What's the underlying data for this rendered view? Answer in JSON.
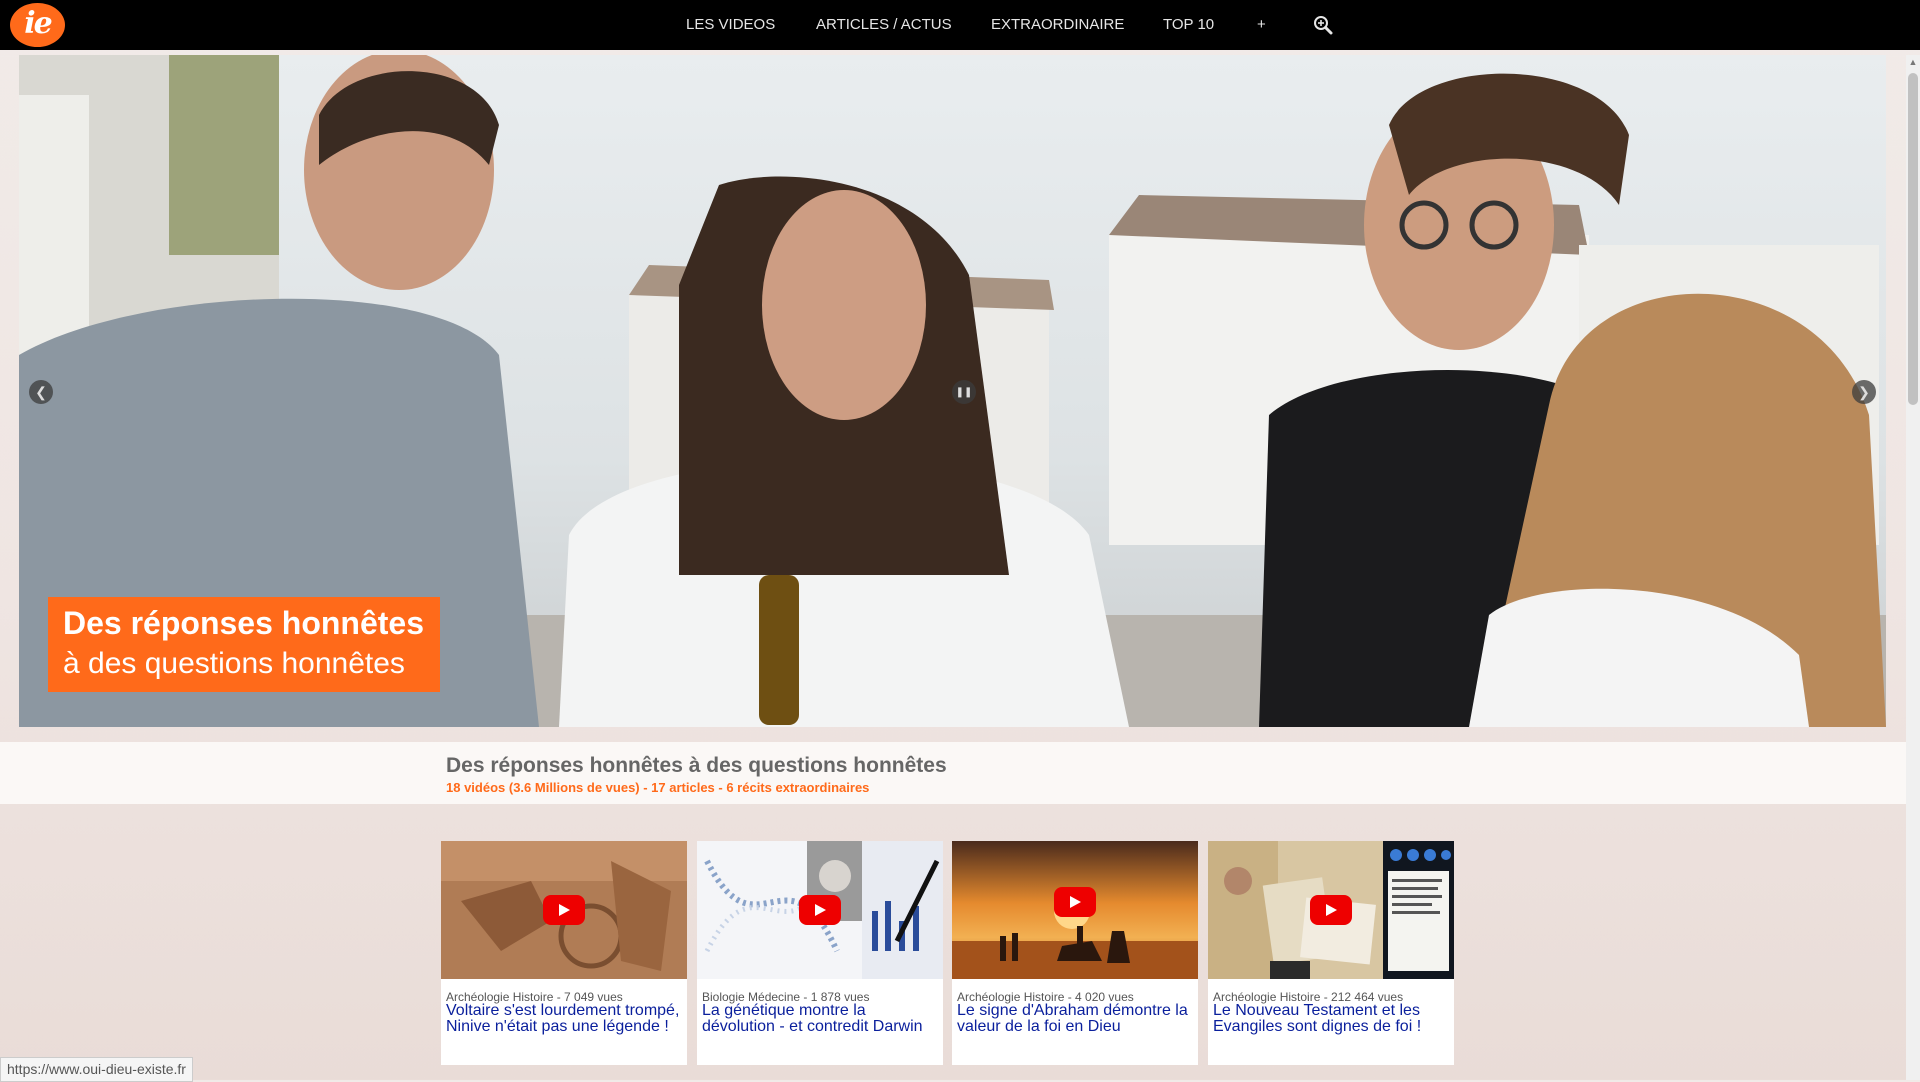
{
  "brand": {
    "logo_text": "ie"
  },
  "nav": {
    "items": [
      "LES VIDEOS",
      "ARTICLES / ACTUS",
      "EXTRAORDINAIRE",
      "TOP 10",
      "+"
    ],
    "search_icon": "search-zoom-icon"
  },
  "hero": {
    "title": "Des réponses honnêtes",
    "subtitle": "à des questions honnêtes",
    "prev_icon": "chevron-left-icon",
    "pause_icon": "pause-icon",
    "next_icon": "chevron-right-icon"
  },
  "band": {
    "title": "Des réponses honnêtes à des questions honnêtes",
    "stats": "18 vidéos  (3.6 Millions de vues)   -   17 articles   -   6 récits extraordinaires"
  },
  "videos": [
    {
      "meta": "Archéologie Histoire - 7 049 vues",
      "title": "Voltaire s'est lourdement trompé, Ninive n'était pas une légende !"
    },
    {
      "meta": "Biologie Médecine - 1 878 vues",
      "title": "La génétique montre la dévolution - et contredit Darwin"
    },
    {
      "meta": "Archéologie Histoire - 4 020 vues",
      "title": "Le signe d'Abraham démontre la valeur de la foi en Dieu"
    },
    {
      "meta": "Archéologie Histoire - 212 464 vues",
      "title": "Le Nouveau Testament et les Evangiles sont dignes de foi !"
    }
  ],
  "status_url": "https://www.oui-dieu-existe.fr",
  "colors": {
    "accent": "#ff6a1a",
    "link": "#0a1f9c",
    "nav_bg": "#000000",
    "play": "#ee0000"
  }
}
